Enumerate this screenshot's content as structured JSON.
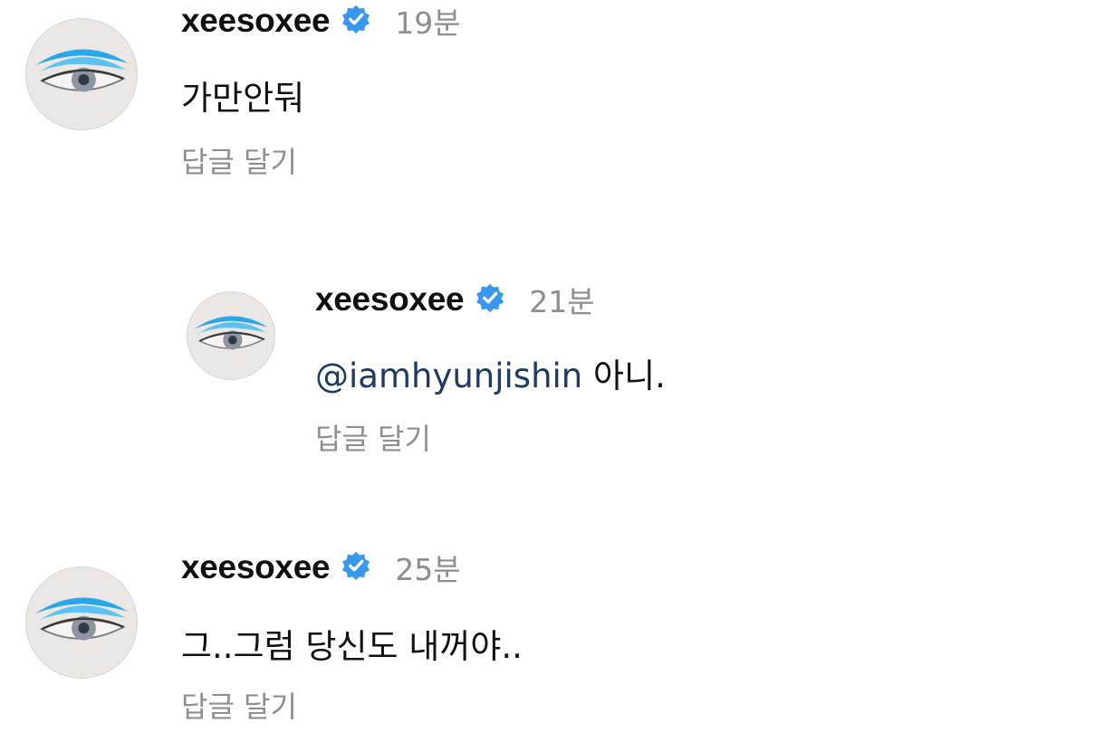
{
  "comments": [
    {
      "username": "xeesoxee",
      "verified_icon": "verified-badge-icon",
      "time": "19분",
      "text": "가만안둬",
      "reply_label": "답글 달기"
    },
    {
      "username": "xeesoxee",
      "verified_icon": "verified-badge-icon",
      "time": "21분",
      "mention": "@iamhyunjishin",
      "text": " 아니.",
      "reply_label": "답글 달기"
    },
    {
      "username": "xeesoxee",
      "verified_icon": "verified-badge-icon",
      "time": "25분",
      "text": "그..그럼 당신도 내꺼야..",
      "reply_label": "답글 달기"
    }
  ],
  "colors": {
    "verified": "#3897f0",
    "mention": "#1f3a63",
    "muted": "#8e8e8e",
    "eyeshadow": "#2aa7e8"
  }
}
